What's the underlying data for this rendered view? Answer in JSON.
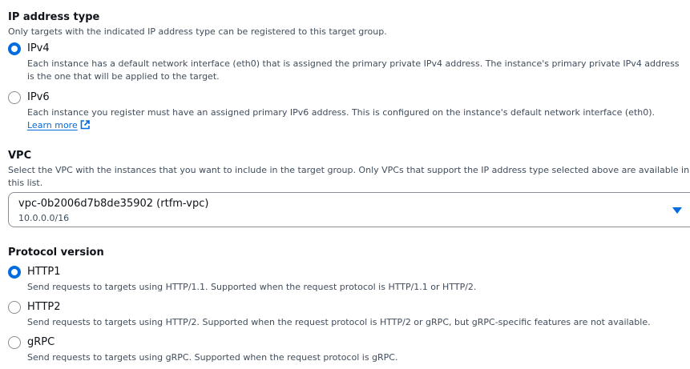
{
  "ip_type": {
    "title": "IP address type",
    "description": "Only targets with the indicated IP address type can be registered to this target group.",
    "options": [
      {
        "label": "IPv4",
        "description": "Each instance has a default network interface (eth0) that is assigned the primary private IPv4 address. The instance's primary private IPv4 address is the one that will be applied to the target.",
        "selected": true
      },
      {
        "label": "IPv6",
        "description": "Each instance you register must have an assigned primary IPv6 address. This is configured on the instance's default network interface (eth0).",
        "link": "Learn more",
        "selected": false
      }
    ]
  },
  "vpc": {
    "title": "VPC",
    "description": "Select the VPC with the instances that you want to include in the target group. Only VPCs that support the IP address type selected above are available in this list.",
    "selected_value": "vpc-0b2006d7b8de35902 (rtfm-vpc)",
    "selected_sub": "10.0.0.0/16"
  },
  "protocol": {
    "title": "Protocol version",
    "options": [
      {
        "label": "HTTP1",
        "description": "Send requests to targets using HTTP/1.1. Supported when the request protocol is HTTP/1.1 or HTTP/2.",
        "selected": true
      },
      {
        "label": "HTTP2",
        "description": "Send requests to targets using HTTP/2. Supported when the request protocol is HTTP/2 or gRPC, but gRPC-specific features are not available.",
        "selected": false
      },
      {
        "label": "gRPC",
        "description": "Send requests to targets using gRPC. Supported when the request protocol is gRPC.",
        "selected": false
      }
    ]
  },
  "colors": {
    "accent": "#006ce0",
    "text": "#0f141a",
    "secondary_text": "#414d5c",
    "border": "#8c8c94"
  }
}
